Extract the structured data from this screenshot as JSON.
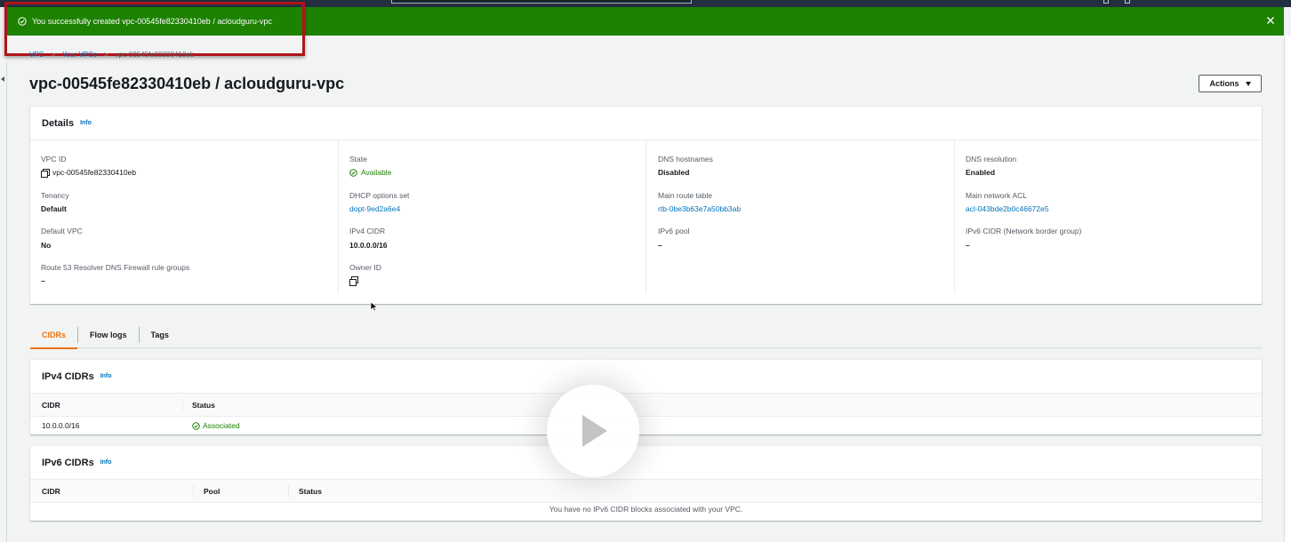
{
  "flash": {
    "message": "You successfully created vpc-00545fe82330410eb / acloudguru-vpc",
    "color": "#1d8102"
  },
  "breadcrumb": {
    "root": "VPC",
    "parent": "Your VPCs",
    "current": "vpc-00545fe82330410eb"
  },
  "page": {
    "title": "vpc-00545fe82330410eb / acloudguru-vpc",
    "actions_label": "Actions"
  },
  "details": {
    "heading": "Details",
    "info": "Info",
    "fields": {
      "vpc_id": {
        "label": "VPC ID",
        "value": "vpc-00545fe82330410eb"
      },
      "tenancy": {
        "label": "Tenancy",
        "value": "Default"
      },
      "default_vpc": {
        "label": "Default VPC",
        "value": "No"
      },
      "route53": {
        "label": "Route 53 Resolver DNS Firewall rule groups",
        "value": "–"
      },
      "state": {
        "label": "State",
        "value": "Available"
      },
      "dhcp": {
        "label": "DHCP options set",
        "value": "dopt-9ed2a6e4"
      },
      "ipv4_cidr": {
        "label": "IPv4 CIDR",
        "value": "10.0.0.0/16"
      },
      "owner_id": {
        "label": "Owner ID",
        "value": ""
      },
      "dns_hostnames": {
        "label": "DNS hostnames",
        "value": "Disabled"
      },
      "main_route_table": {
        "label": "Main route table",
        "value": "rtb-0be3b63e7a50bb3ab"
      },
      "ipv6_pool": {
        "label": "IPv6 pool",
        "value": "–"
      },
      "dns_resolution": {
        "label": "DNS resolution",
        "value": "Enabled"
      },
      "main_network_acl": {
        "label": "Main network ACL",
        "value": "acl-043bde2b0c46672e5"
      },
      "ipv6_cidr_nbg": {
        "label": "IPv6 CIDR (Network border group)",
        "value": "–"
      }
    }
  },
  "tabs": [
    {
      "label": "CIDRs",
      "active": true
    },
    {
      "label": "Flow logs",
      "active": false
    },
    {
      "label": "Tags",
      "active": false
    }
  ],
  "ipv4_cidrs": {
    "heading": "IPv4 CIDRs",
    "info": "Info",
    "columns": [
      "CIDR",
      "Status"
    ],
    "rows": [
      {
        "cidr": "10.0.0.0/16",
        "status": "Associated"
      }
    ]
  },
  "ipv6_cidrs": {
    "heading": "IPv6 CIDRs",
    "info": "Info",
    "columns": [
      "CIDR",
      "Pool",
      "Status"
    ],
    "empty_message": "You have no IPv6 CIDR blocks associated with your VPC."
  },
  "icons": {
    "success": "check-circle-icon",
    "close": "close-icon",
    "copy": "copy-icon",
    "play": "play-icon"
  }
}
